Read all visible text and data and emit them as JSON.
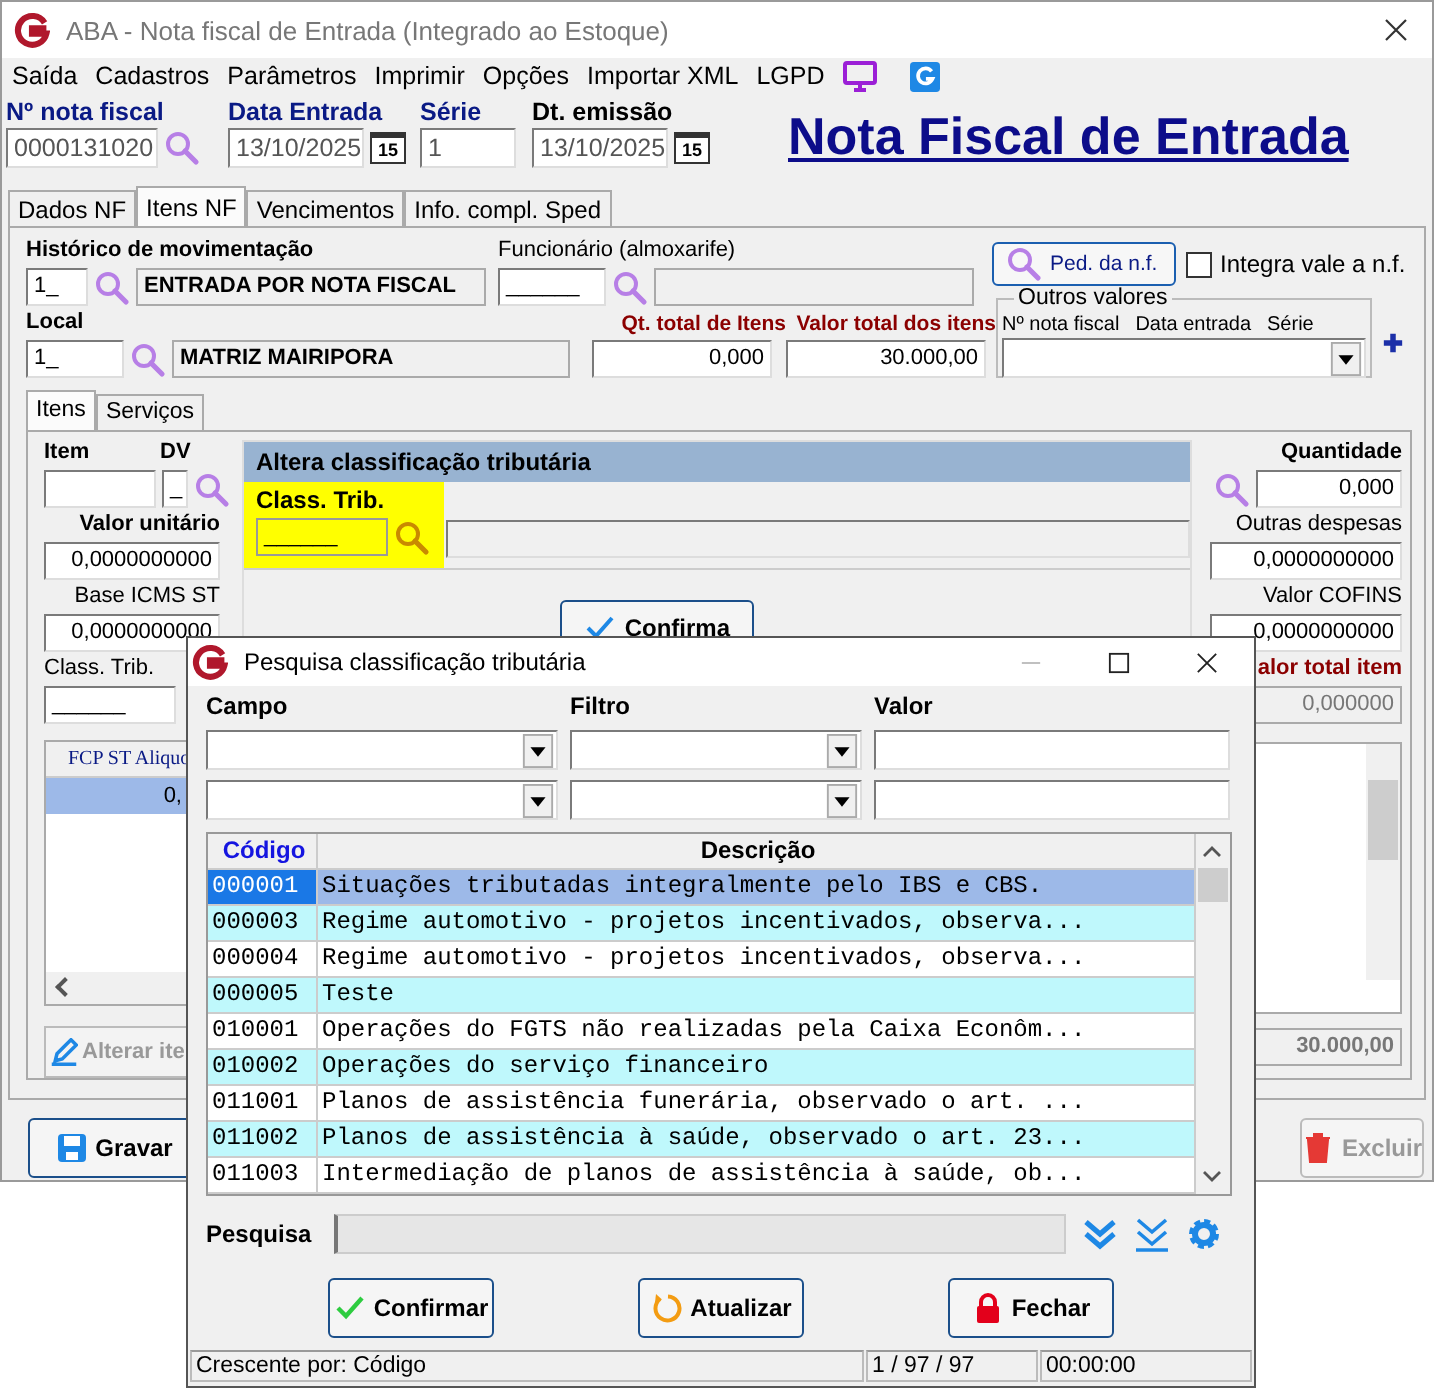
{
  "window": {
    "title": "ABA - Nota fiscal de Entrada (Integrado ao Estoque)"
  },
  "menu": [
    "Saída",
    "Cadastros",
    "Parâmetros",
    "Imprimir",
    "Opções",
    "Importar XML",
    "LGPD"
  ],
  "header": {
    "fields": [
      {
        "label": "Nº nota fiscal",
        "value": "0000131020",
        "kind": "search",
        "highlighted": true
      },
      {
        "label": "Data Entrada",
        "value": "13/10/2025",
        "kind": "date",
        "calendar": "15",
        "highlighted": true
      },
      {
        "label": "Série",
        "value": "1",
        "kind": "plain",
        "highlighted": true
      },
      {
        "label": "Dt. emissão",
        "value": "13/10/2025",
        "kind": "date",
        "calendar": "15",
        "highlighted": false
      }
    ],
    "heading": "Nota Fiscal de Entrada"
  },
  "tabs": [
    {
      "label": "Dados NF",
      "selected": false
    },
    {
      "label": "Itens NF",
      "selected": true
    },
    {
      "label": "Vencimentos",
      "selected": false
    },
    {
      "label": "Info. compl. Sped",
      "selected": false
    }
  ],
  "form": {
    "historico": {
      "label": "Histórico de movimentação",
      "code": "1_",
      "name": "ENTRADA POR NOTA FISCAL"
    },
    "funcionario": {
      "label": "Funcionário (almoxarife)",
      "code": "______"
    },
    "ped_button": "Ped. da n.f.",
    "integra": {
      "label": "Integra vale a n.f.",
      "checked": false
    },
    "outros_valores": {
      "title": "Outros valores",
      "columns": [
        "Nº nota fiscal",
        "Data entrada",
        "Série"
      ]
    },
    "local": {
      "label": "Local",
      "code": "1_",
      "name": "MATRIZ MAIRIPORA"
    },
    "qt_total": {
      "label": "Qt. total de Itens",
      "value": "0,000"
    },
    "valor_total": {
      "label": "Valor total dos itens",
      "value": "30.000,00"
    }
  },
  "subtabs": [
    {
      "label": "Itens",
      "selected": true
    },
    {
      "label": "Serviços",
      "selected": false
    }
  ],
  "item_panel": {
    "item_label": "Item",
    "dv_label": "DV",
    "dv_value": "_",
    "valor_unitario": {
      "label": "Valor unitário",
      "value": "0,0000000000"
    },
    "base_icms_st": {
      "label": "Base ICMS ST",
      "value": "0,0000000000"
    },
    "class_trib": {
      "label": "Class. Trib.",
      "value": "______"
    },
    "grid": {
      "column": "FCP ST Aliquo",
      "value": "0,"
    },
    "alterar_button": {
      "label": "Alterar ite",
      "disabled": true
    }
  },
  "class_panel": {
    "title": "Altera classificação tributária",
    "label": "Class. Trib.",
    "value": "______",
    "button": "Confirma"
  },
  "right_panel": {
    "quantidade": {
      "label": "Quantidade",
      "value": "0,000"
    },
    "outras_despesas": {
      "label": "Outras despesas",
      "value": "0,0000000000"
    },
    "valor_cofins": {
      "label": "Valor COFINS",
      "value": "0,0000000000"
    },
    "valor_total_item": {
      "label": "alor total item",
      "value": "0,000000"
    },
    "total": "30.000,00"
  },
  "footer_buttons": [
    {
      "label": "Gravar",
      "kind": "save",
      "disabled": false
    },
    {
      "label": "Excluir",
      "kind": "delete",
      "disabled": true
    }
  ],
  "dialog": {
    "title": "Pesquisa classificação tributária",
    "filter_labels": [
      "Campo",
      "Filtro",
      "Valor"
    ],
    "columns": [
      "Código",
      "Descrição"
    ],
    "rows": [
      {
        "code": "000001",
        "description": "Situações tributadas integralmente pelo IBS e CBS.",
        "selected": true
      },
      {
        "code": "000003",
        "description": "Regime automotivo - projetos incentivados, observa...",
        "selected": false
      },
      {
        "code": "000004",
        "description": "Regime automotivo - projetos incentivados, observa...",
        "selected": false
      },
      {
        "code": "000005",
        "description": "Teste",
        "selected": false
      },
      {
        "code": "010001",
        "description": "Operações do FGTS não realizadas pela Caixa Econôm...",
        "selected": false
      },
      {
        "code": "010002",
        "description": "Operações do serviço financeiro",
        "selected": false
      },
      {
        "code": "011001",
        "description": "Planos de assistência funerária, observado o art. ...",
        "selected": false
      },
      {
        "code": "011002",
        "description": "Planos de assistência à saúde, observado o art. 23...",
        "selected": false
      },
      {
        "code": "011003",
        "description": "Intermediação de planos de assistência à saúde, ob...",
        "selected": false
      }
    ],
    "search_label": "Pesquisa",
    "buttons": [
      {
        "label": "Confirmar",
        "kind": "confirm"
      },
      {
        "label": "Atualizar",
        "kind": "refresh"
      },
      {
        "label": "Fechar",
        "kind": "close"
      }
    ],
    "status": [
      "Crescente por: Código",
      "1 / 97 / 97",
      "00:00:00"
    ]
  }
}
